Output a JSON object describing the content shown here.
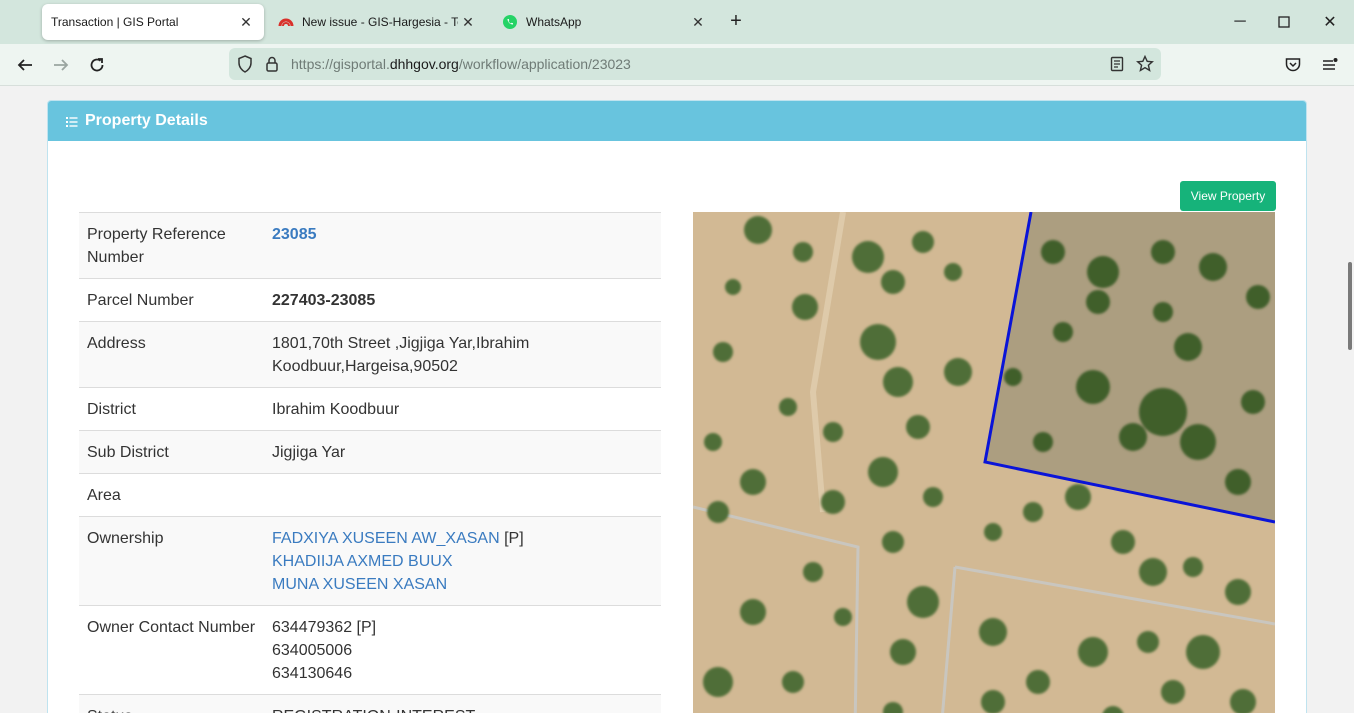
{
  "browser": {
    "tabs": [
      {
        "title": "Transaction | GIS Portal",
        "active": true,
        "icon": "none"
      },
      {
        "title": "New issue - GIS-Hargesia - Team",
        "active": false,
        "icon": "gitlab-arc-icon"
      },
      {
        "title": "WhatsApp",
        "active": false,
        "icon": "whatsapp-icon"
      }
    ],
    "url_prefix": "https://gisportal.",
    "url_domain": "dhhgov.org",
    "url_path": "/workflow/application/23023"
  },
  "panel": {
    "title": "Property Details",
    "view_button": "View Property"
  },
  "details": {
    "rows": [
      {
        "label": "Property Reference Number",
        "value": "23085"
      },
      {
        "label": "Parcel Number",
        "value": "227403-23085"
      },
      {
        "label": "Address",
        "value": "1801,70th Street ,Jigjiga Yar,Ibrahim Koodbuur,Hargeisa,90502"
      },
      {
        "label": "District",
        "value": "Ibrahim Koodbuur"
      },
      {
        "label": "Sub District",
        "value": "Jigjiga Yar"
      },
      {
        "label": "Area",
        "value": ""
      },
      {
        "label": "Ownership",
        "owners": [
          {
            "name": "FADXIYA XUSEEN AW_XASAN",
            "tag": "[P]"
          },
          {
            "name": "KHADIIJA AXMED BUUX",
            "tag": ""
          },
          {
            "name": "MUNA XUSEEN XASAN",
            "tag": ""
          }
        ]
      },
      {
        "label": "Owner Contact Number",
        "contacts": [
          "634479362 [P]",
          "634005006",
          "634130646"
        ]
      },
      {
        "label": "Status",
        "value": "REGISTRATION-INTEREST"
      }
    ]
  },
  "colors": {
    "header": "#68c4de",
    "button": "#16b37a",
    "link": "#3a7bc0",
    "parcel_line": "#0a14d8"
  }
}
